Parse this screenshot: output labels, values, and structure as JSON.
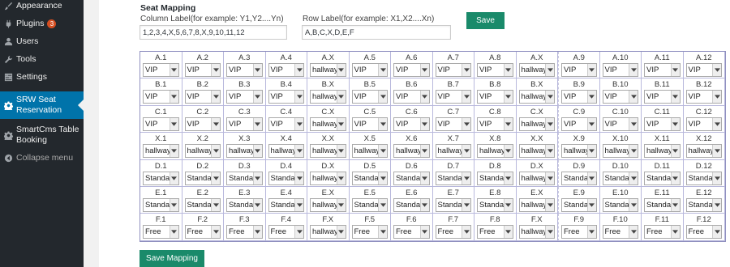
{
  "sidebar": {
    "items": [
      {
        "label": "Appearance",
        "icon": "brush-icon"
      },
      {
        "label": "Plugins",
        "icon": "plug-icon",
        "badge": "3"
      },
      {
        "label": "Users",
        "icon": "user-icon"
      },
      {
        "label": "Tools",
        "icon": "wrench-icon"
      },
      {
        "label": "Settings",
        "icon": "sliders-icon"
      },
      {
        "label_line1": "SRW Seat",
        "label_line2": "Reservation",
        "icon": "gear-icon"
      },
      {
        "label_line1": "SmartCms Table",
        "label_line2": "Booking",
        "icon": "gear-icon"
      },
      {
        "label": "Collapse menu",
        "icon": "collapse-icon"
      }
    ]
  },
  "seat_mapping": {
    "title": "Seat Mapping",
    "column_label": "Column Label(for example: Y1,Y2....Yn)",
    "column_value": "1,2,3,4,X,5,6,7,8,X,9,10,11,12",
    "row_label": "Row Label(for example: X1,X2....Xn)",
    "row_value": "A,B,C,X,D,E,F",
    "save_label": "Save",
    "save_mapping_label": "Save Mapping"
  },
  "grid": {
    "columns": [
      "1",
      "2",
      "3",
      "4",
      "X",
      "5",
      "6",
      "7",
      "8",
      "X",
      "9",
      "10",
      "11",
      "12"
    ],
    "rows": [
      {
        "row": "A",
        "names": [
          "A.1",
          "A.2",
          "A.3",
          "A.4",
          "A.X",
          "A.5",
          "A.6",
          "A.7",
          "A.8",
          "A.X",
          "A.9",
          "A.10",
          "A.11",
          "A.12"
        ],
        "values": [
          "VIP",
          "VIP",
          "VIP",
          "VIP",
          "hallway",
          "VIP",
          "VIP",
          "VIP",
          "VIP",
          "hallway",
          "VIP",
          "VIP",
          "VIP",
          "VIP"
        ]
      },
      {
        "row": "B",
        "names": [
          "B.1",
          "B.2",
          "B.3",
          "B.4",
          "B.X",
          "B.5",
          "B.6",
          "B.7",
          "B.8",
          "B.X",
          "B.9",
          "B.10",
          "B.11",
          "B.12"
        ],
        "values": [
          "VIP",
          "VIP",
          "VIP",
          "VIP",
          "hallway",
          "VIP",
          "VIP",
          "VIP",
          "VIP",
          "hallway",
          "VIP",
          "VIP",
          "VIP",
          "VIP"
        ]
      },
      {
        "row": "C",
        "names": [
          "C.1",
          "C.2",
          "C.3",
          "C.4",
          "C.X",
          "C.5",
          "C.6",
          "C.7",
          "C.8",
          "C.X",
          "C.9",
          "C.10",
          "C.11",
          "C.12"
        ],
        "values": [
          "VIP",
          "VIP",
          "VIP",
          "VIP",
          "hallway",
          "VIP",
          "VIP",
          "VIP",
          "VIP",
          "hallway",
          "VIP",
          "VIP",
          "VIP",
          "VIP"
        ]
      },
      {
        "row": "X",
        "names": [
          "X.1",
          "X.2",
          "X.3",
          "X.4",
          "X.X",
          "X.5",
          "X.6",
          "X.7",
          "X.8",
          "X.X",
          "X.9",
          "X.10",
          "X.11",
          "X.12"
        ],
        "values": [
          "hallway",
          "hallway",
          "hallway",
          "hallway",
          "hallway",
          "hallway",
          "hallway",
          "hallway",
          "hallway",
          "hallway",
          "hallway",
          "hallway",
          "hallway",
          "hallway"
        ]
      },
      {
        "row": "D",
        "names": [
          "D.1",
          "D.2",
          "D.3",
          "D.4",
          "D.X",
          "D.5",
          "D.6",
          "D.7",
          "D.8",
          "D.X",
          "D.9",
          "D.10",
          "D.11",
          "D.12"
        ],
        "values": [
          "Standa",
          "Standa",
          "Standa",
          "Standa",
          "hallway",
          "Standa",
          "Standa",
          "Standa",
          "Standa",
          "hallway",
          "Standa",
          "Standa",
          "Standa",
          "Standa"
        ]
      },
      {
        "row": "E",
        "names": [
          "E.1",
          "E.2",
          "E.3",
          "E.4",
          "E.X",
          "E.5",
          "E.6",
          "E.7",
          "E.8",
          "E.X",
          "E.9",
          "E.10",
          "E.11",
          "E.12"
        ],
        "values": [
          "Standa",
          "Standa",
          "Standa",
          "Standa",
          "hallway",
          "Standa",
          "Standa",
          "Standa",
          "Standa",
          "hallway",
          "Standa",
          "Standa",
          "Standa",
          "Standa"
        ]
      },
      {
        "row": "F",
        "names": [
          "F.1",
          "F.2",
          "F.3",
          "F.4",
          "F.X",
          "F.5",
          "F.6",
          "F.7",
          "F.8",
          "F.X",
          "F.9",
          "F.10",
          "F.11",
          "F.12"
        ],
        "values": [
          "Free",
          "Free",
          "Free",
          "Free",
          "hallway",
          "Free",
          "Free",
          "Free",
          "Free",
          "hallway",
          "Free",
          "Free",
          "Free",
          "Free"
        ]
      }
    ]
  },
  "colors": {
    "sidebar_bg": "#23282d",
    "current_item_bg": "#0073aa",
    "button_bg": "#1a8a6a",
    "badge_bg": "#d54e21"
  }
}
